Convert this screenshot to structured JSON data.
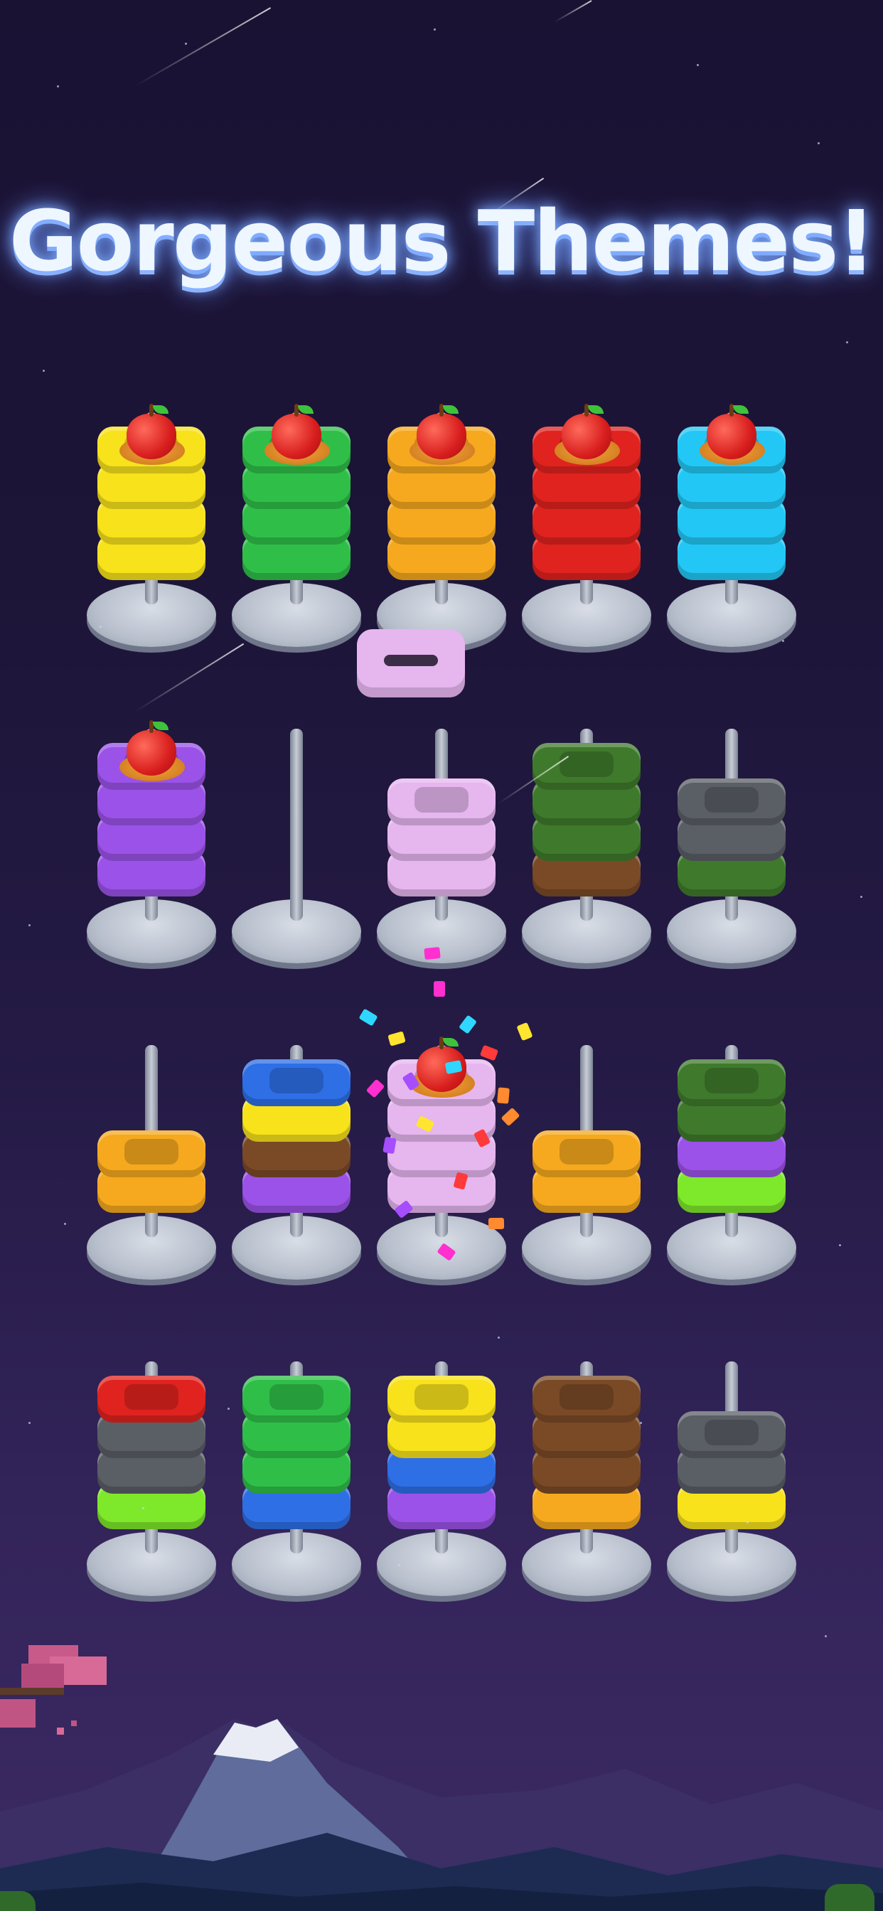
{
  "header": {
    "title": "Gorgeous Themes!"
  },
  "colors": {
    "yellow": "#f7e21b",
    "green": "#2fbf48",
    "orange": "#f6a91e",
    "red": "#e0231f",
    "cyan": "#23c7f5",
    "purple": "#9b52e8",
    "lilac": "#e6b6ef",
    "darkgreen": "#3f7a2c",
    "brown": "#7a4a26",
    "gray": "#5a5f66",
    "blue": "#2e6fe6",
    "lime": "#7ee82a"
  },
  "board": {
    "rows": [
      {
        "tubes": [
          {
            "rings": [
              "yellow",
              "yellow",
              "yellow",
              "yellow"
            ],
            "apple": true
          },
          {
            "rings": [
              "green",
              "green",
              "green",
              "green"
            ],
            "apple": true
          },
          {
            "rings": [
              "orange",
              "orange",
              "orange",
              "orange"
            ],
            "apple": true
          },
          {
            "rings": [
              "red",
              "red",
              "red",
              "red"
            ],
            "apple": true
          },
          {
            "rings": [
              "cyan",
              "cyan",
              "cyan",
              "cyan"
            ],
            "apple": true
          }
        ]
      },
      {
        "tubes": [
          {
            "rings": [
              "purple",
              "purple",
              "purple",
              "purple"
            ],
            "apple": true
          },
          {
            "rings": [],
            "apple": false
          },
          {
            "rings": [
              "lilac",
              "lilac",
              "lilac"
            ],
            "apple": false,
            "lifted": "lilac"
          },
          {
            "rings": [
              "brown",
              "darkgreen",
              "darkgreen",
              "darkgreen"
            ],
            "apple": false
          },
          {
            "rings": [
              "darkgreen",
              "gray",
              "gray"
            ],
            "apple": false
          }
        ]
      },
      {
        "tubes": [
          {
            "rings": [
              "orange",
              "orange"
            ],
            "apple": false
          },
          {
            "rings": [
              "purple",
              "brown",
              "yellow",
              "blue"
            ],
            "apple": false
          },
          {
            "rings": [
              "lilac",
              "lilac",
              "lilac",
              "lilac"
            ],
            "apple": true,
            "burst": true
          },
          {
            "rings": [
              "orange",
              "orange"
            ],
            "apple": false
          },
          {
            "rings": [
              "lime",
              "purple",
              "darkgreen",
              "darkgreen"
            ],
            "apple": false
          }
        ]
      },
      {
        "tubes": [
          {
            "rings": [
              "lime",
              "gray",
              "gray",
              "red"
            ],
            "apple": false
          },
          {
            "rings": [
              "blue",
              "green",
              "green",
              "green"
            ],
            "apple": false
          },
          {
            "rings": [
              "purple",
              "blue",
              "yellow",
              "yellow"
            ],
            "apple": false
          },
          {
            "rings": [
              "orange",
              "brown",
              "brown",
              "brown"
            ],
            "apple": false
          },
          {
            "rings": [
              "yellow",
              "gray",
              "gray"
            ],
            "apple": false
          }
        ]
      }
    ]
  }
}
